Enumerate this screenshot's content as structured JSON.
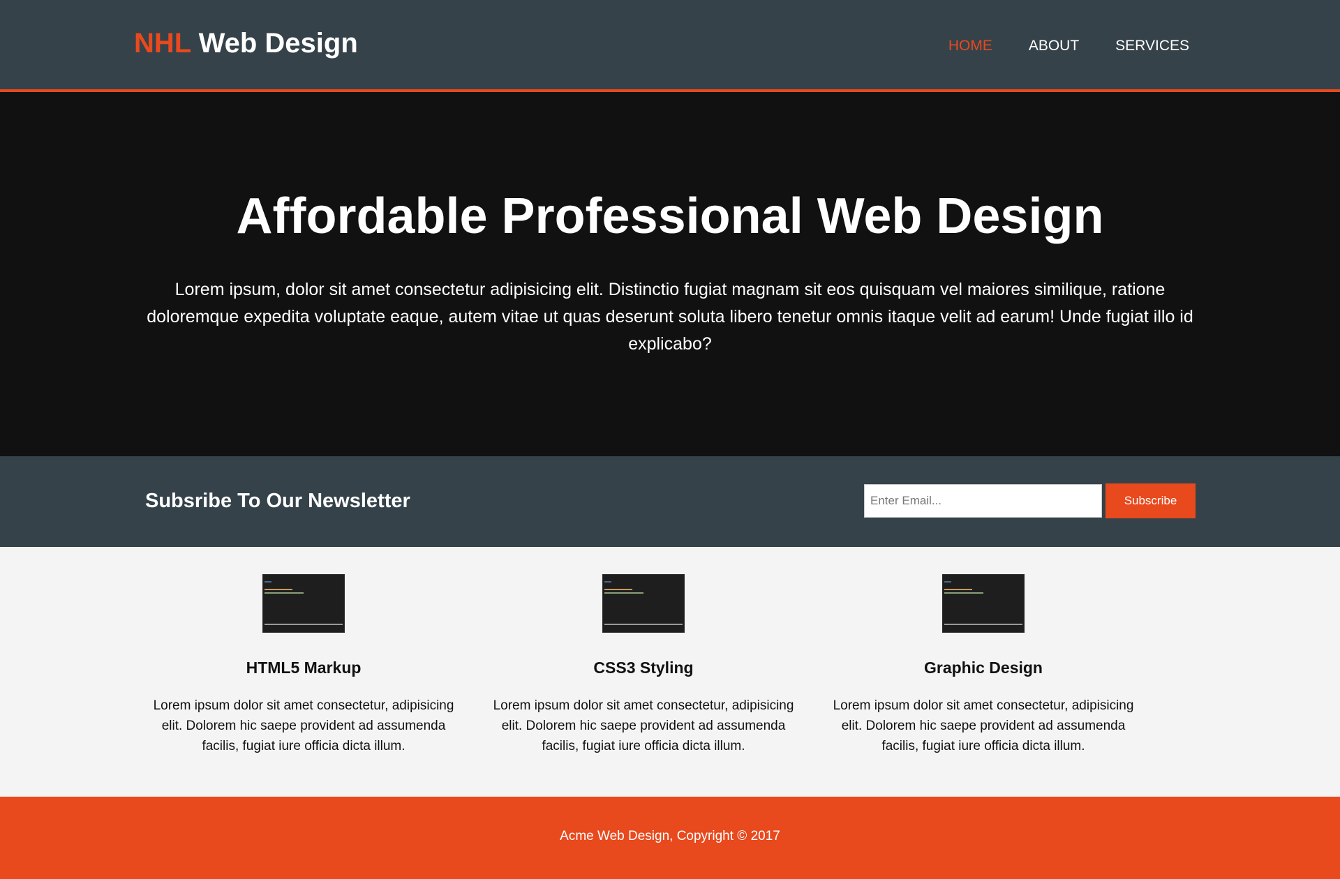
{
  "header": {
    "logo_highlight": "NHL",
    "logo_rest": " Web Design",
    "nav": [
      {
        "label": "Home"
      },
      {
        "label": "About"
      },
      {
        "label": "Services"
      }
    ]
  },
  "showcase": {
    "title": "Affordable Professional Web Design",
    "text": "Lorem ipsum, dolor sit amet consectetur adipisicing elit. Distinctio fugiat magnam sit eos quisquam vel maiores similique, ratione doloremque expedita voluptate eaque, autem vitae ut quas deserunt soluta libero tenetur omnis itaque velit ad earum! Unde fugiat illo id explicabo?"
  },
  "newsletter": {
    "heading": "Subsribe To Our Newsletter",
    "email_placeholder": "Enter Email...",
    "email_value": "",
    "button_label": "Subscribe"
  },
  "boxes": [
    {
      "title": "HTML5 Markup",
      "text": "Lorem ipsum dolor sit amet consectetur, adipisicing elit. Dolorem hic saepe provident ad assumenda facilis, fugiat iure officia dicta illum."
    },
    {
      "title": "CSS3 Styling",
      "text": "Lorem ipsum dolor sit amet consectetur, adipisicing elit. Dolorem hic saepe provident ad assumenda facilis, fugiat iure officia dicta illum."
    },
    {
      "title": "Graphic Design",
      "text": "Lorem ipsum dolor sit amet consectetur, adipisicing elit. Dolorem hic saepe provident ad assumenda facilis, fugiat iure officia dicta illum."
    }
  ],
  "footer": {
    "text": "Acme Web Design, Copyright © 2017"
  },
  "colors": {
    "accent": "#e8491d",
    "header_bg": "#35424a",
    "showcase_bg": "#111111",
    "body_bg": "#f4f4f4"
  }
}
